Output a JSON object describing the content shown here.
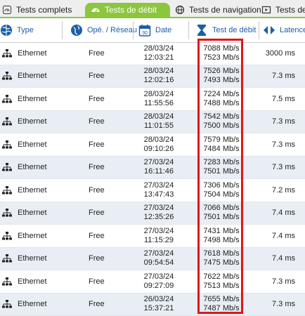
{
  "tabs": [
    {
      "label": "Tests complets",
      "icon": "speedometer-icon",
      "active": false
    },
    {
      "label": "Tests de débit",
      "icon": "gauge-icon",
      "active": true
    },
    {
      "label": "Tests de navigation",
      "icon": "globe-icon",
      "active": false
    },
    {
      "label": "Tests de",
      "icon": "video-icon",
      "active": false
    }
  ],
  "columns": {
    "type": "Type",
    "operator": "Opé. / Réseau",
    "date": "Date",
    "speed": "Test de débit",
    "latency": "Latence"
  },
  "colors": {
    "accent": "#8cc63f",
    "header_text": "#1a5fa8",
    "highlight": "#e0161b",
    "alt_row": "#e8eef4"
  },
  "rows": [
    {
      "type": "Ethernet",
      "operator": "Free",
      "date": "28/03/24",
      "time": "12:03:21",
      "down": "7088 Mb/s",
      "up": "7523 Mb/s",
      "latency": "3000 ms"
    },
    {
      "type": "Ethernet",
      "operator": "Free",
      "date": "28/03/24",
      "time": "12:02:16",
      "down": "7526 Mb/s",
      "up": "7493 Mb/s",
      "latency": "7.3 ms"
    },
    {
      "type": "Ethernet",
      "operator": "Free",
      "date": "28/03/24",
      "time": "11:55:56",
      "down": "7224 Mb/s",
      "up": "7488 Mb/s",
      "latency": "7.5 ms"
    },
    {
      "type": "Ethernet",
      "operator": "Free",
      "date": "28/03/24",
      "time": "11:01:55",
      "down": "7542 Mb/s",
      "up": "7500 Mb/s",
      "latency": "7.3 ms"
    },
    {
      "type": "Ethernet",
      "operator": "Free",
      "date": "28/03/24",
      "time": "09:10:26",
      "down": "7579 Mb/s",
      "up": "7484 Mb/s",
      "latency": "7.3 ms"
    },
    {
      "type": "Ethernet",
      "operator": "Free",
      "date": "27/03/24",
      "time": "16:11:46",
      "down": "7283 Mb/s",
      "up": "7501 Mb/s",
      "latency": "7.3 ms"
    },
    {
      "type": "Ethernet",
      "operator": "Free",
      "date": "27/03/24",
      "time": "13:47:43",
      "down": "7306 Mb/s",
      "up": "7504 Mb/s",
      "latency": "7.2 ms"
    },
    {
      "type": "Ethernet",
      "operator": "Free",
      "date": "27/03/24",
      "time": "12:35:26",
      "down": "7066 Mb/s",
      "up": "7501 Mb/s",
      "latency": "7.4 ms"
    },
    {
      "type": "Ethernet",
      "operator": "Free",
      "date": "27/03/24",
      "time": "11:15:29",
      "down": "7431 Mb/s",
      "up": "7498 Mb/s",
      "latency": "7.4 ms"
    },
    {
      "type": "Ethernet",
      "operator": "Free",
      "date": "27/03/24",
      "time": "09:54:54",
      "down": "7618 Mb/s",
      "up": "7475 Mb/s",
      "latency": "7.4 ms"
    },
    {
      "type": "Ethernet",
      "operator": "Free",
      "date": "27/03/24",
      "time": "09:27:09",
      "down": "7622 Mb/s",
      "up": "7513 Mb/s",
      "latency": "7.3 ms"
    },
    {
      "type": "Ethernet",
      "operator": "Free",
      "date": "26/03/24",
      "time": "15:37:21",
      "down": "7655 Mb/s",
      "up": "7487 Mb/s",
      "latency": "7.3 ms"
    }
  ]
}
